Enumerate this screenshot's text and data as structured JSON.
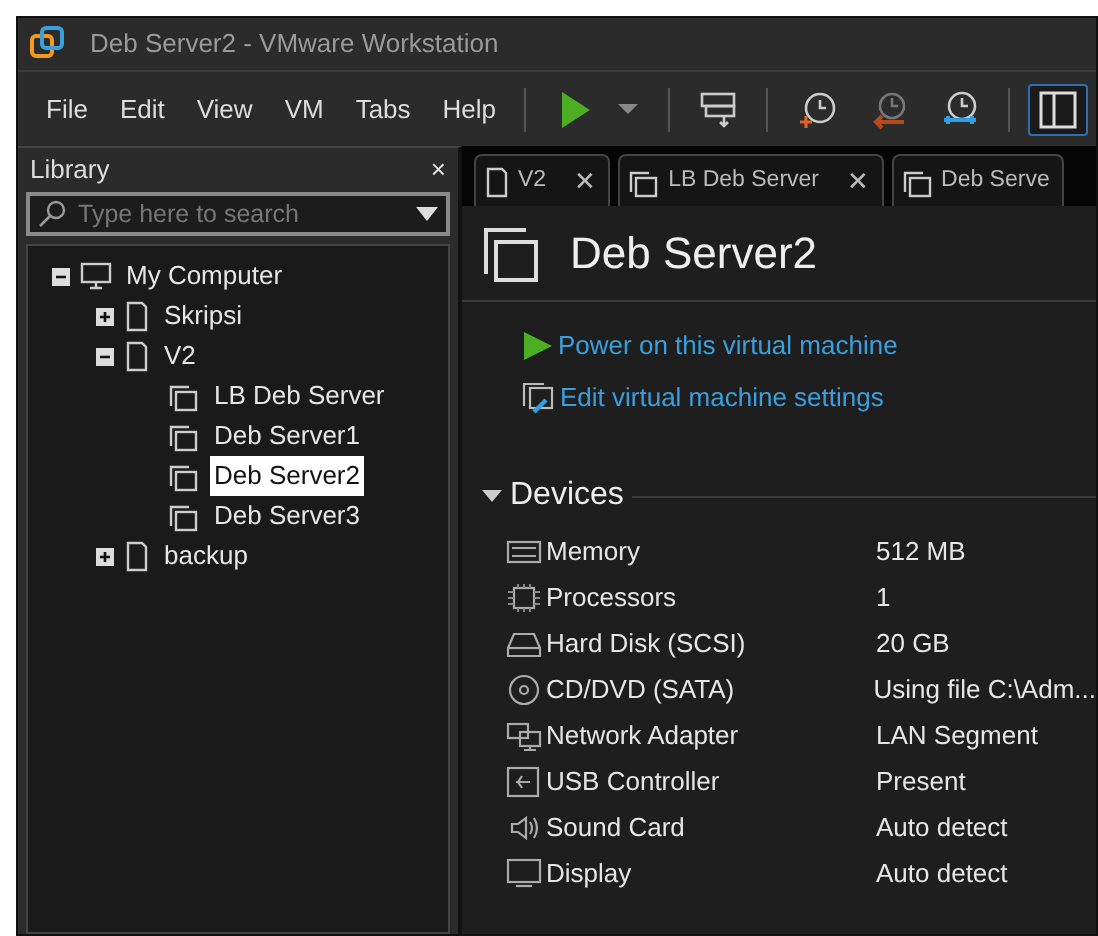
{
  "window": {
    "title": "Deb Server2 - VMware Workstation"
  },
  "menu": [
    "File",
    "Edit",
    "View",
    "VM",
    "Tabs",
    "Help"
  ],
  "toolbar": [
    {
      "kind": "play"
    },
    {
      "kind": "caret"
    },
    {
      "kind": "sep"
    },
    {
      "kind": "keys"
    },
    {
      "kind": "sep"
    },
    {
      "kind": "snap-take"
    },
    {
      "kind": "snap-revert"
    },
    {
      "kind": "snap-manage"
    },
    {
      "kind": "sep"
    },
    {
      "kind": "view-split",
      "selected": true
    }
  ],
  "library": {
    "title": "Library",
    "close": "×",
    "search": {
      "placeholder": "Type here to search"
    },
    "tree": [
      {
        "label": "My Computer",
        "kind": "computer",
        "expanded": true,
        "selected": false,
        "children": [
          {
            "label": "Skripsi",
            "kind": "folder",
            "expanded": false,
            "selected": false
          },
          {
            "label": "V2",
            "kind": "folder",
            "expanded": true,
            "selected": false,
            "children": [
              {
                "label": "LB Deb Server",
                "kind": "vm",
                "selected": false
              },
              {
                "label": "Deb Server1",
                "kind": "vm",
                "selected": false
              },
              {
                "label": "Deb Server2",
                "kind": "vm",
                "selected": true
              },
              {
                "label": "Deb Server3",
                "kind": "vm",
                "selected": false
              }
            ]
          },
          {
            "label": "backup",
            "kind": "folder",
            "expanded": false,
            "selected": false
          }
        ]
      }
    ]
  },
  "tabs": [
    {
      "label": "V2",
      "kind": "folder",
      "close": "✕",
      "selected": false
    },
    {
      "label": "LB Deb Server",
      "kind": "vm",
      "close": "✕",
      "selected": false
    },
    {
      "label": "Deb Serve",
      "kind": "vm",
      "selected": false
    }
  ],
  "vm": {
    "name": "Deb Server2",
    "actions": [
      {
        "label": "Power on this virtual machine",
        "kind": "power"
      },
      {
        "label": "Edit virtual machine settings",
        "kind": "settings"
      }
    ],
    "devices": {
      "title": "Devices",
      "expanded": true,
      "rows": [
        {
          "kind": "memory",
          "name": "Memory",
          "value": "512 MB"
        },
        {
          "kind": "processor",
          "name": "Processors",
          "value": "1"
        },
        {
          "kind": "disk",
          "name": "Hard Disk (SCSI)",
          "value": "20 GB"
        },
        {
          "kind": "cd",
          "name": "CD/DVD (SATA)",
          "value": "Using file C:\\Adm..."
        },
        {
          "kind": "network",
          "name": "Network Adapter",
          "value": "LAN Segment"
        },
        {
          "kind": "usb",
          "name": "USB Controller",
          "value": "Present"
        },
        {
          "kind": "sound",
          "name": "Sound Card",
          "value": "Auto detect"
        },
        {
          "kind": "display",
          "name": "Display",
          "value": "Auto detect"
        }
      ]
    }
  }
}
